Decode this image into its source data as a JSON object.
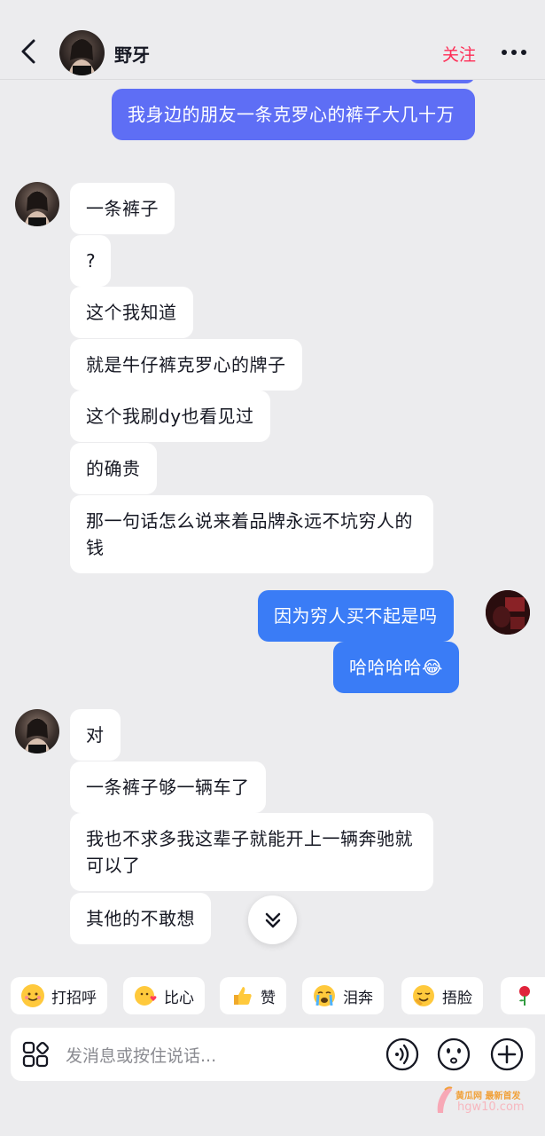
{
  "header": {
    "name": "野牙",
    "follow_label": "关注"
  },
  "messages": {
    "m0": "我身边的朋友一条克罗心的裤子大几十万",
    "m1": "一条裤子",
    "m2": "?",
    "m3": "这个我知道",
    "m4": "就是牛仔裤克罗心的牌子",
    "m5": "这个我刷dy也看见过",
    "m6": "的确贵",
    "m7": "那一句话怎么说来着品牌永远不坑穷人的钱",
    "m8": "因为穷人买不起是吗",
    "m9": "哈哈哈哈😂",
    "m10": "对",
    "m11": "一条裤子够一辆车了",
    "m12": "我也不求多我这辈子就能开上一辆奔驰就可以了",
    "m13": "其他的不敢想"
  },
  "quick_replies": [
    {
      "label": "打招呼",
      "icon": "wave-emoji-icon"
    },
    {
      "label": "比心",
      "icon": "heart-hands-emoji-icon"
    },
    {
      "label": "赞",
      "icon": "thumbs-up-emoji-icon"
    },
    {
      "label": "泪奔",
      "icon": "crying-emoji-icon"
    },
    {
      "label": "捂脸",
      "icon": "facepalm-emoji-icon"
    },
    {
      "label": "",
      "icon": "rose-emoji-icon"
    }
  ],
  "input": {
    "placeholder": "发消息或按住说话..."
  },
  "watermark": {
    "line1": "黄瓜网 最新首发",
    "line2": "hgw10.com"
  },
  "colors": {
    "outgoing_bubble": "#3a7cf6",
    "outgoing_bubble_top": "#5e6ef5",
    "incoming_bubble": "#ffffff",
    "follow": "#fe2c55",
    "background": "#ececee"
  }
}
